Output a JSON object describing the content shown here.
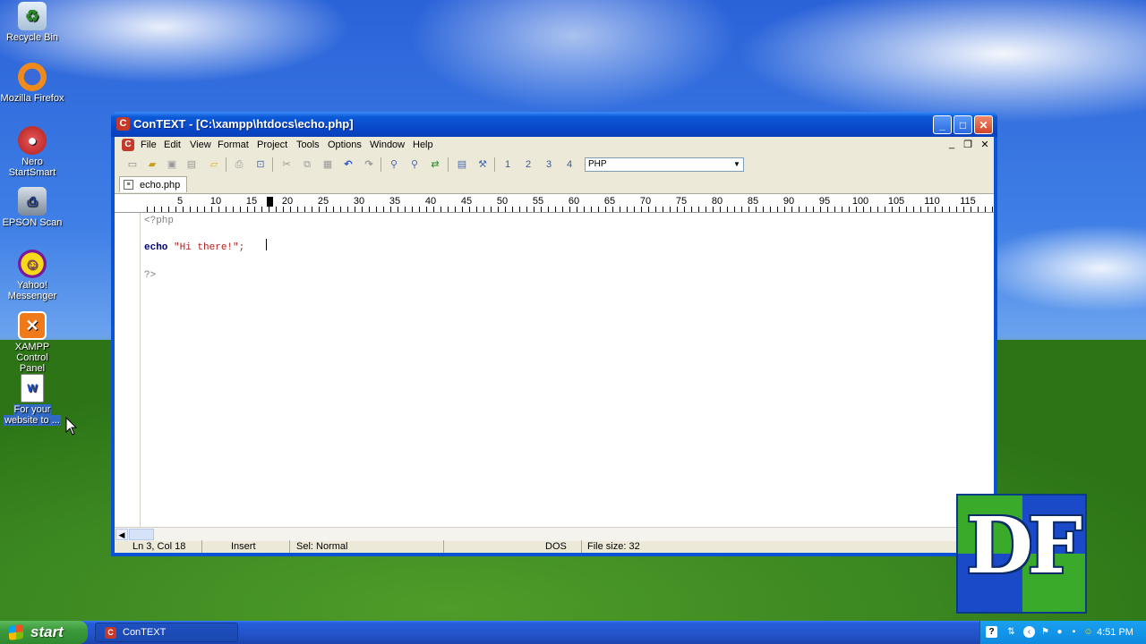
{
  "desktop": {
    "icons": [
      {
        "label_line1": "Recycle Bin",
        "label_line2": "",
        "icon": "recycle-bin-icon"
      },
      {
        "label_line1": "Mozilla Firefox",
        "label_line2": "",
        "icon": "firefox-icon"
      },
      {
        "label_line1": "Nero",
        "label_line2": "StartSmart",
        "icon": "nero-icon"
      },
      {
        "label_line1": "EPSON Scan",
        "label_line2": "",
        "icon": "epson-scan-icon"
      },
      {
        "label_line1": "Yahoo!",
        "label_line2": "Messenger",
        "icon": "yahoo-messenger-icon"
      },
      {
        "label_line1": "XAMPP Control",
        "label_line2": "Panel",
        "icon": "xampp-icon"
      },
      {
        "label_line1": "For your",
        "label_line2": "website to ...",
        "icon": "word-document-icon"
      }
    ]
  },
  "window": {
    "title": "ConTEXT - [C:\\xampp\\htdocs\\echo.php]",
    "buttons": {
      "minimize": "_",
      "maximize": "□",
      "close": "✕"
    }
  },
  "menu": {
    "items": [
      "File",
      "Edit",
      "View",
      "Format",
      "Project",
      "Tools",
      "Options",
      "Window",
      "Help"
    ],
    "mdi": {
      "minimize": "_",
      "restore": "❐",
      "close": "✕"
    }
  },
  "toolbar": {
    "language": "PHP",
    "buttons": [
      "new-file-icon",
      "open-file-icon",
      "save-icon",
      "save-all-icon",
      "open-folder-icon",
      "print-icon",
      "print-preview-icon",
      "cut-icon",
      "copy-icon",
      "paste-icon",
      "undo-icon",
      "redo-icon",
      "find-icon",
      "find-next-icon",
      "replace-icon",
      "export-icon",
      "tools-icon",
      "user-command-1-icon",
      "user-command-2-icon",
      "user-command-3-icon",
      "user-command-4-icon"
    ],
    "user_cmd_labels": [
      "1",
      "2",
      "3",
      "4"
    ]
  },
  "tab": {
    "label": "echo.php"
  },
  "ruler": {
    "numbers": [
      "5",
      "10",
      "15",
      "20",
      "25",
      "30",
      "35",
      "40",
      "45",
      "50",
      "55",
      "60",
      "65",
      "70",
      "75",
      "80",
      "85",
      "90",
      "95",
      "100",
      "105",
      "110",
      "115"
    ]
  },
  "editor": {
    "lines": [
      {
        "open_tag": "<?php"
      },
      {
        "keyword": "echo",
        "string": "\"Hi there!\"",
        "end": ";"
      },
      {
        "close_tag": "?>"
      }
    ]
  },
  "status": {
    "position": "Ln 3, Col 18",
    "mode": "Insert",
    "selection": "Sel: Normal",
    "line_endings": "DOS",
    "file_size": "File size: 32"
  },
  "taskbar": {
    "start_label": "start",
    "task_label": "ConTEXT",
    "clock": "4:51 PM"
  },
  "logo": {
    "text": "DF"
  },
  "colors": {
    "titlebar": "#0846c8",
    "keyword": "#000080",
    "string": "#b02020",
    "taskbar": "#245edb"
  }
}
